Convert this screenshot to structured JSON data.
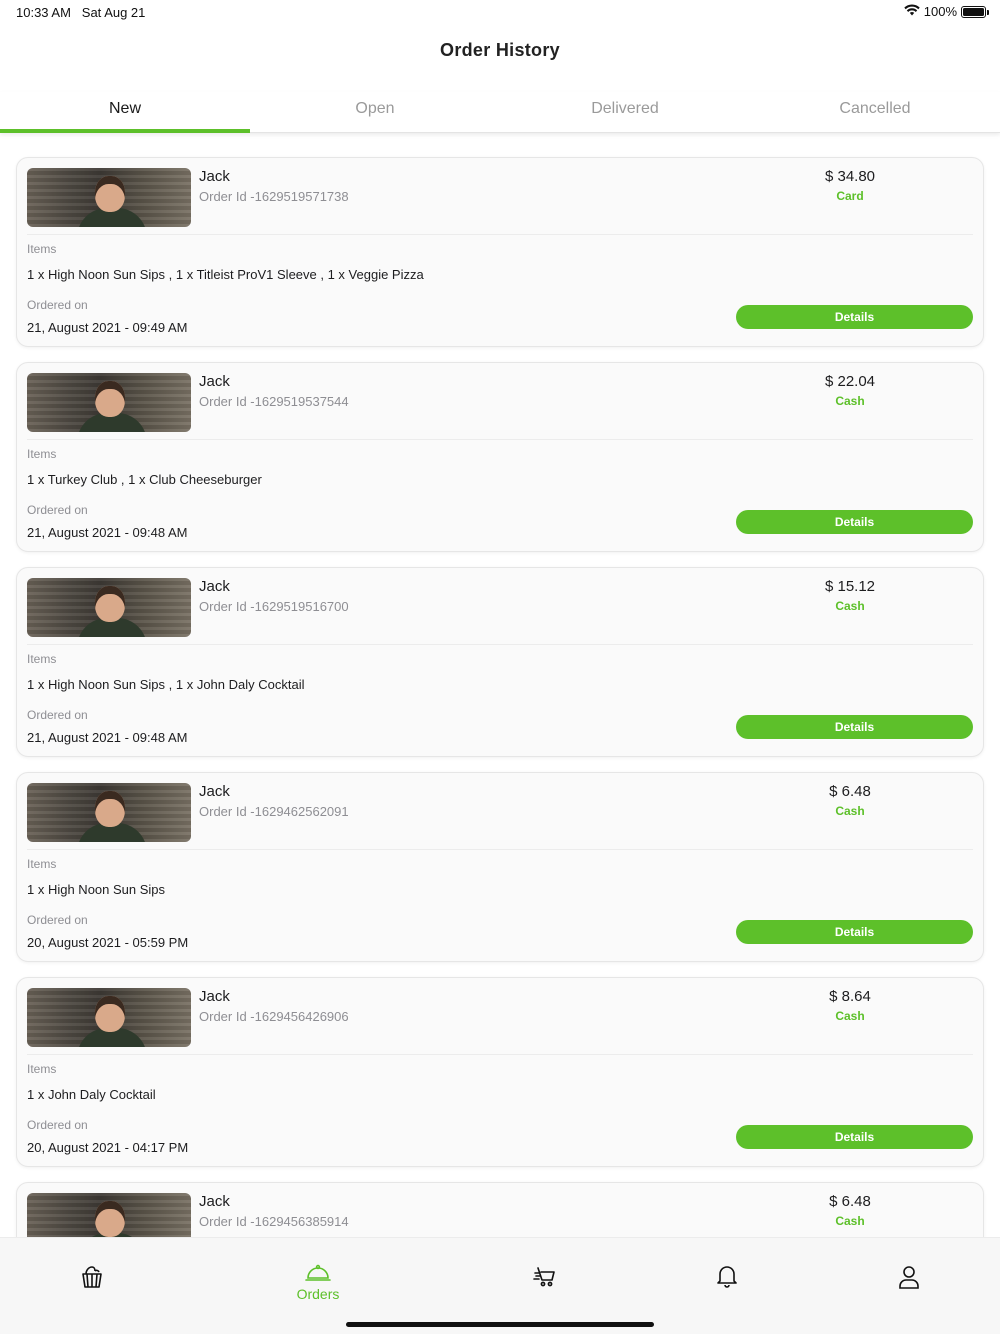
{
  "status_bar": {
    "time": "10:33 AM",
    "date": "Sat Aug 21",
    "battery": "100%",
    "battery_level": 1.0
  },
  "header": {
    "title": "Order History"
  },
  "tabs": [
    {
      "label": "New",
      "active": true
    },
    {
      "label": "Open",
      "active": false
    },
    {
      "label": "Delivered",
      "active": false
    },
    {
      "label": "Cancelled",
      "active": false
    }
  ],
  "colors": {
    "accent": "#5dc02a",
    "muted_text": "#8e8e93",
    "card_bg": "#fafafa"
  },
  "labels": {
    "items": "Items",
    "ordered_on": "Ordered on",
    "details": "Details"
  },
  "orders": [
    {
      "customer": "Jack",
      "order_id": "Order Id -1629519571738",
      "price": "$ 34.80",
      "payment": "Card",
      "items": "1 x High Noon Sun Sips , 1 x Titleist ProV1 Sleeve , 1 x Veggie Pizza",
      "ordered_on": "21, August 2021 - 09:49 AM"
    },
    {
      "customer": "Jack",
      "order_id": "Order Id -1629519537544",
      "price": "$ 22.04",
      "payment": "Cash",
      "items": "1 x Turkey Club , 1 x Club Cheeseburger",
      "ordered_on": "21, August 2021 - 09:48 AM"
    },
    {
      "customer": "Jack",
      "order_id": "Order Id -1629519516700",
      "price": "$ 15.12",
      "payment": "Cash",
      "items": "1 x High Noon Sun Sips , 1 x John Daly Cocktail",
      "ordered_on": "21, August 2021 - 09:48 AM"
    },
    {
      "customer": "Jack",
      "order_id": "Order Id -1629462562091",
      "price": "$ 6.48",
      "payment": "Cash",
      "items": "1 x High Noon Sun Sips",
      "ordered_on": "20, August 2021 - 05:59 PM"
    },
    {
      "customer": "Jack",
      "order_id": "Order Id -1629456426906",
      "price": "$ 8.64",
      "payment": "Cash",
      "items": "1 x John Daly Cocktail",
      "ordered_on": "20, August 2021 - 04:17 PM"
    },
    {
      "customer": "Jack",
      "order_id": "Order Id -1629456385914",
      "price": "$ 6.48",
      "payment": "Cash",
      "items": "",
      "ordered_on": ""
    }
  ],
  "bottom_nav": [
    {
      "icon": "food-basket-icon",
      "label": ""
    },
    {
      "icon": "cloche-icon",
      "label": "Orders",
      "active": true
    },
    {
      "icon": "delivery-cart-icon",
      "label": ""
    },
    {
      "icon": "bell-icon",
      "label": ""
    },
    {
      "icon": "user-icon",
      "label": ""
    }
  ]
}
